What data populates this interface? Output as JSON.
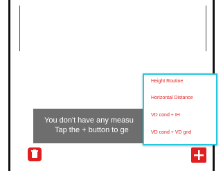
{
  "toast": {
    "line1": "You don't have any measu",
    "line2": "Tap the + button to ge"
  },
  "menu": {
    "items": [
      {
        "label": "Height Routine"
      },
      {
        "label": "Horizontal Distance"
      },
      {
        "label": "VD cond + IH"
      },
      {
        "label": "VD cond + VD gnd"
      }
    ]
  },
  "icons": {
    "delete": "trash-icon",
    "add": "plus-icon"
  },
  "colors": {
    "accent": "#e02020",
    "menu_border": "#22c8e0",
    "toast_bg": "#6e6e6e"
  }
}
